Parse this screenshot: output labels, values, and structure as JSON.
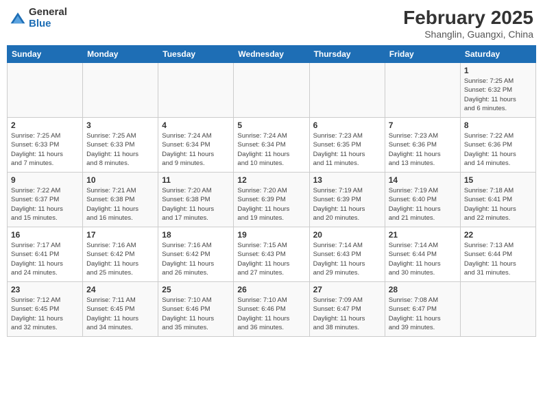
{
  "header": {
    "logo_general": "General",
    "logo_blue": "Blue",
    "month_title": "February 2025",
    "location": "Shanglin, Guangxi, China"
  },
  "days_of_week": [
    "Sunday",
    "Monday",
    "Tuesday",
    "Wednesday",
    "Thursday",
    "Friday",
    "Saturday"
  ],
  "weeks": [
    [
      {
        "day": "",
        "info": ""
      },
      {
        "day": "",
        "info": ""
      },
      {
        "day": "",
        "info": ""
      },
      {
        "day": "",
        "info": ""
      },
      {
        "day": "",
        "info": ""
      },
      {
        "day": "",
        "info": ""
      },
      {
        "day": "1",
        "info": "Sunrise: 7:25 AM\nSunset: 6:32 PM\nDaylight: 11 hours\nand 6 minutes."
      }
    ],
    [
      {
        "day": "2",
        "info": "Sunrise: 7:25 AM\nSunset: 6:33 PM\nDaylight: 11 hours\nand 7 minutes."
      },
      {
        "day": "3",
        "info": "Sunrise: 7:25 AM\nSunset: 6:33 PM\nDaylight: 11 hours\nand 8 minutes."
      },
      {
        "day": "4",
        "info": "Sunrise: 7:24 AM\nSunset: 6:34 PM\nDaylight: 11 hours\nand 9 minutes."
      },
      {
        "day": "5",
        "info": "Sunrise: 7:24 AM\nSunset: 6:34 PM\nDaylight: 11 hours\nand 10 minutes."
      },
      {
        "day": "6",
        "info": "Sunrise: 7:23 AM\nSunset: 6:35 PM\nDaylight: 11 hours\nand 11 minutes."
      },
      {
        "day": "7",
        "info": "Sunrise: 7:23 AM\nSunset: 6:36 PM\nDaylight: 11 hours\nand 13 minutes."
      },
      {
        "day": "8",
        "info": "Sunrise: 7:22 AM\nSunset: 6:36 PM\nDaylight: 11 hours\nand 14 minutes."
      }
    ],
    [
      {
        "day": "9",
        "info": "Sunrise: 7:22 AM\nSunset: 6:37 PM\nDaylight: 11 hours\nand 15 minutes."
      },
      {
        "day": "10",
        "info": "Sunrise: 7:21 AM\nSunset: 6:38 PM\nDaylight: 11 hours\nand 16 minutes."
      },
      {
        "day": "11",
        "info": "Sunrise: 7:20 AM\nSunset: 6:38 PM\nDaylight: 11 hours\nand 17 minutes."
      },
      {
        "day": "12",
        "info": "Sunrise: 7:20 AM\nSunset: 6:39 PM\nDaylight: 11 hours\nand 19 minutes."
      },
      {
        "day": "13",
        "info": "Sunrise: 7:19 AM\nSunset: 6:39 PM\nDaylight: 11 hours\nand 20 minutes."
      },
      {
        "day": "14",
        "info": "Sunrise: 7:19 AM\nSunset: 6:40 PM\nDaylight: 11 hours\nand 21 minutes."
      },
      {
        "day": "15",
        "info": "Sunrise: 7:18 AM\nSunset: 6:41 PM\nDaylight: 11 hours\nand 22 minutes."
      }
    ],
    [
      {
        "day": "16",
        "info": "Sunrise: 7:17 AM\nSunset: 6:41 PM\nDaylight: 11 hours\nand 24 minutes."
      },
      {
        "day": "17",
        "info": "Sunrise: 7:16 AM\nSunset: 6:42 PM\nDaylight: 11 hours\nand 25 minutes."
      },
      {
        "day": "18",
        "info": "Sunrise: 7:16 AM\nSunset: 6:42 PM\nDaylight: 11 hours\nand 26 minutes."
      },
      {
        "day": "19",
        "info": "Sunrise: 7:15 AM\nSunset: 6:43 PM\nDaylight: 11 hours\nand 27 minutes."
      },
      {
        "day": "20",
        "info": "Sunrise: 7:14 AM\nSunset: 6:43 PM\nDaylight: 11 hours\nand 29 minutes."
      },
      {
        "day": "21",
        "info": "Sunrise: 7:14 AM\nSunset: 6:44 PM\nDaylight: 11 hours\nand 30 minutes."
      },
      {
        "day": "22",
        "info": "Sunrise: 7:13 AM\nSunset: 6:44 PM\nDaylight: 11 hours\nand 31 minutes."
      }
    ],
    [
      {
        "day": "23",
        "info": "Sunrise: 7:12 AM\nSunset: 6:45 PM\nDaylight: 11 hours\nand 32 minutes."
      },
      {
        "day": "24",
        "info": "Sunrise: 7:11 AM\nSunset: 6:45 PM\nDaylight: 11 hours\nand 34 minutes."
      },
      {
        "day": "25",
        "info": "Sunrise: 7:10 AM\nSunset: 6:46 PM\nDaylight: 11 hours\nand 35 minutes."
      },
      {
        "day": "26",
        "info": "Sunrise: 7:10 AM\nSunset: 6:46 PM\nDaylight: 11 hours\nand 36 minutes."
      },
      {
        "day": "27",
        "info": "Sunrise: 7:09 AM\nSunset: 6:47 PM\nDaylight: 11 hours\nand 38 minutes."
      },
      {
        "day": "28",
        "info": "Sunrise: 7:08 AM\nSunset: 6:47 PM\nDaylight: 11 hours\nand 39 minutes."
      },
      {
        "day": "",
        "info": ""
      }
    ]
  ]
}
